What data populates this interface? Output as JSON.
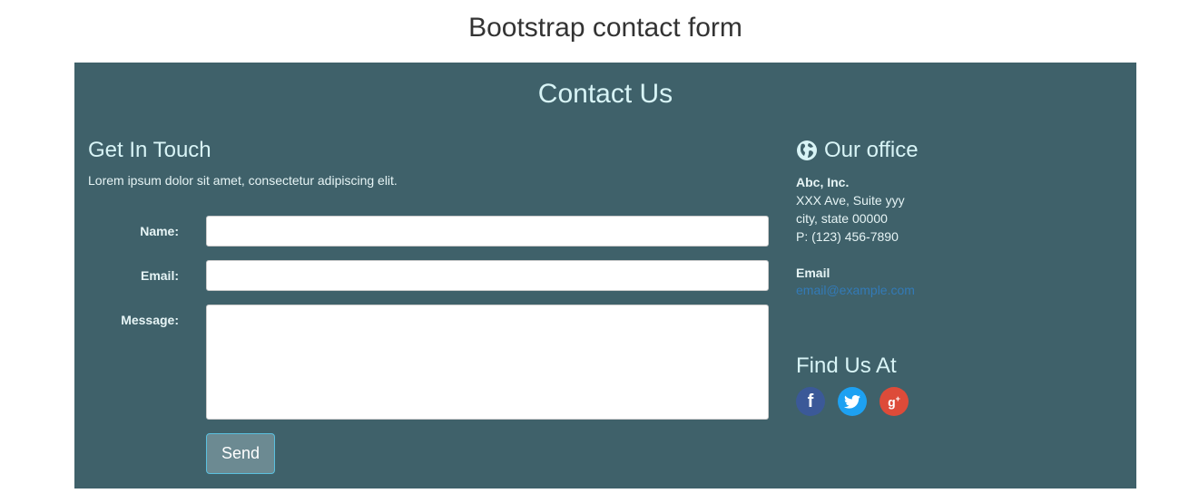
{
  "page": {
    "title": "Bootstrap contact form"
  },
  "panel": {
    "heading": "Contact Us",
    "touch": {
      "heading": "Get In Touch",
      "text": "Lorem ipsum dolor sit amet, consectetur adipiscing elit."
    },
    "form": {
      "name_label": "Name:",
      "email_label": "Email:",
      "message_label": "Message:",
      "name_value": "",
      "email_value": "",
      "message_value": "",
      "send_label": "Send"
    },
    "office": {
      "title": "Our office",
      "company": "Abc, Inc.",
      "street": "XXX Ave, Suite yyy",
      "city": "city, state 00000",
      "phone": "P: (123) 456-7890",
      "email_label": "Email",
      "email_value": "email@example.com"
    },
    "find": {
      "title": "Find Us At",
      "icons": [
        "facebook-icon",
        "twitter-icon",
        "google-plus-icon"
      ]
    }
  },
  "colors": {
    "panel_bg": "#3f616a",
    "heading_text": "#d8f4f6",
    "link": "#337ab7",
    "button_bg": "#6c8a92",
    "facebook": "#3b5998",
    "twitter": "#1da1f2",
    "google_plus": "#dd4b39"
  }
}
